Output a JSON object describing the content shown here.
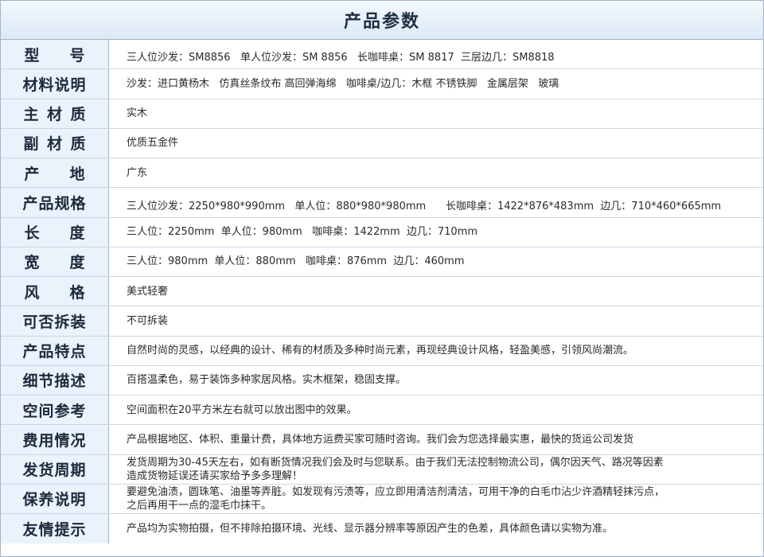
{
  "title": "产品参数",
  "rows": [
    {
      "label": "型号",
      "value": "三人位沙发：SM8856   单人位沙发：SM 8856   长咖啡桌：SM 8817  三层边几：SM8818"
    },
    {
      "label": "材料说明",
      "value": "沙发：进口黄杨木   仿真丝条纹布 高回弹海绵   咖啡桌/边几：木框 不锈铁脚   金属层架   玻璃"
    },
    {
      "label": "主材质",
      "value": "实木"
    },
    {
      "label": "副材质",
      "value": "优质五金件"
    },
    {
      "label": "产地",
      "value": "广东"
    },
    {
      "label": "产品规格",
      "value": "三人位沙发：2250*980*990mm   单人位：880*980*980mm      长咖啡桌：1422*876*483mm  边几：710*460*665mm"
    },
    {
      "label": "长度",
      "value": "三人位：2250mm  单人位：980mm   咖啡桌：1422mm  边几：710mm"
    },
    {
      "label": "宽度",
      "value": "三人位：980mm  单人位：880mm   咖啡桌：876mm  边几：460mm"
    },
    {
      "label": "风格",
      "value": "美式轻奢"
    },
    {
      "label": "可否拆装",
      "value": "不可拆装"
    },
    {
      "label": "产品特点",
      "value": "自然时尚的灵感，以经典的设计、稀有的材质及多种时尚元素，再现经典设计风格，轻盈美感，引领风尚潮流。"
    },
    {
      "label": "细节描述",
      "value": "百搭温柔色，易于装饰多种家居风格。实木框架，稳固支撑。"
    },
    {
      "label": "空间参考",
      "value": "空间面积在20平方米左右就可以放出图中的效果。"
    },
    {
      "label": "费用情况",
      "value": "产品根据地区、体积、重量计费，具体地方运费买家可随时咨询。我们会为您选择最实惠，最快的货运公司发货"
    },
    {
      "label": "发货周期",
      "value": "发货周期为30-45天左右，如有断货情况我们会及时与您联系。由于我们无法控制物流公司，偶尔因天气、路况等因素\n造成货物延误还请买家给予多多理解！"
    },
    {
      "label": "保养说明",
      "value": "要避免油渍，圆珠笔、油墨等弄脏。如发现有污渍等，应立即用清洁剂清洁，可用干净的白毛巾沾少许酒精轻抹污点，\n之后再用干一点的湿毛巾抹干。"
    },
    {
      "label": "友情提示",
      "value": "产品均为实物拍摄，但不排除拍摄环境、光线、显示器分辨率等原因产生的色差，具体颜色请以实物为准。"
    }
  ]
}
